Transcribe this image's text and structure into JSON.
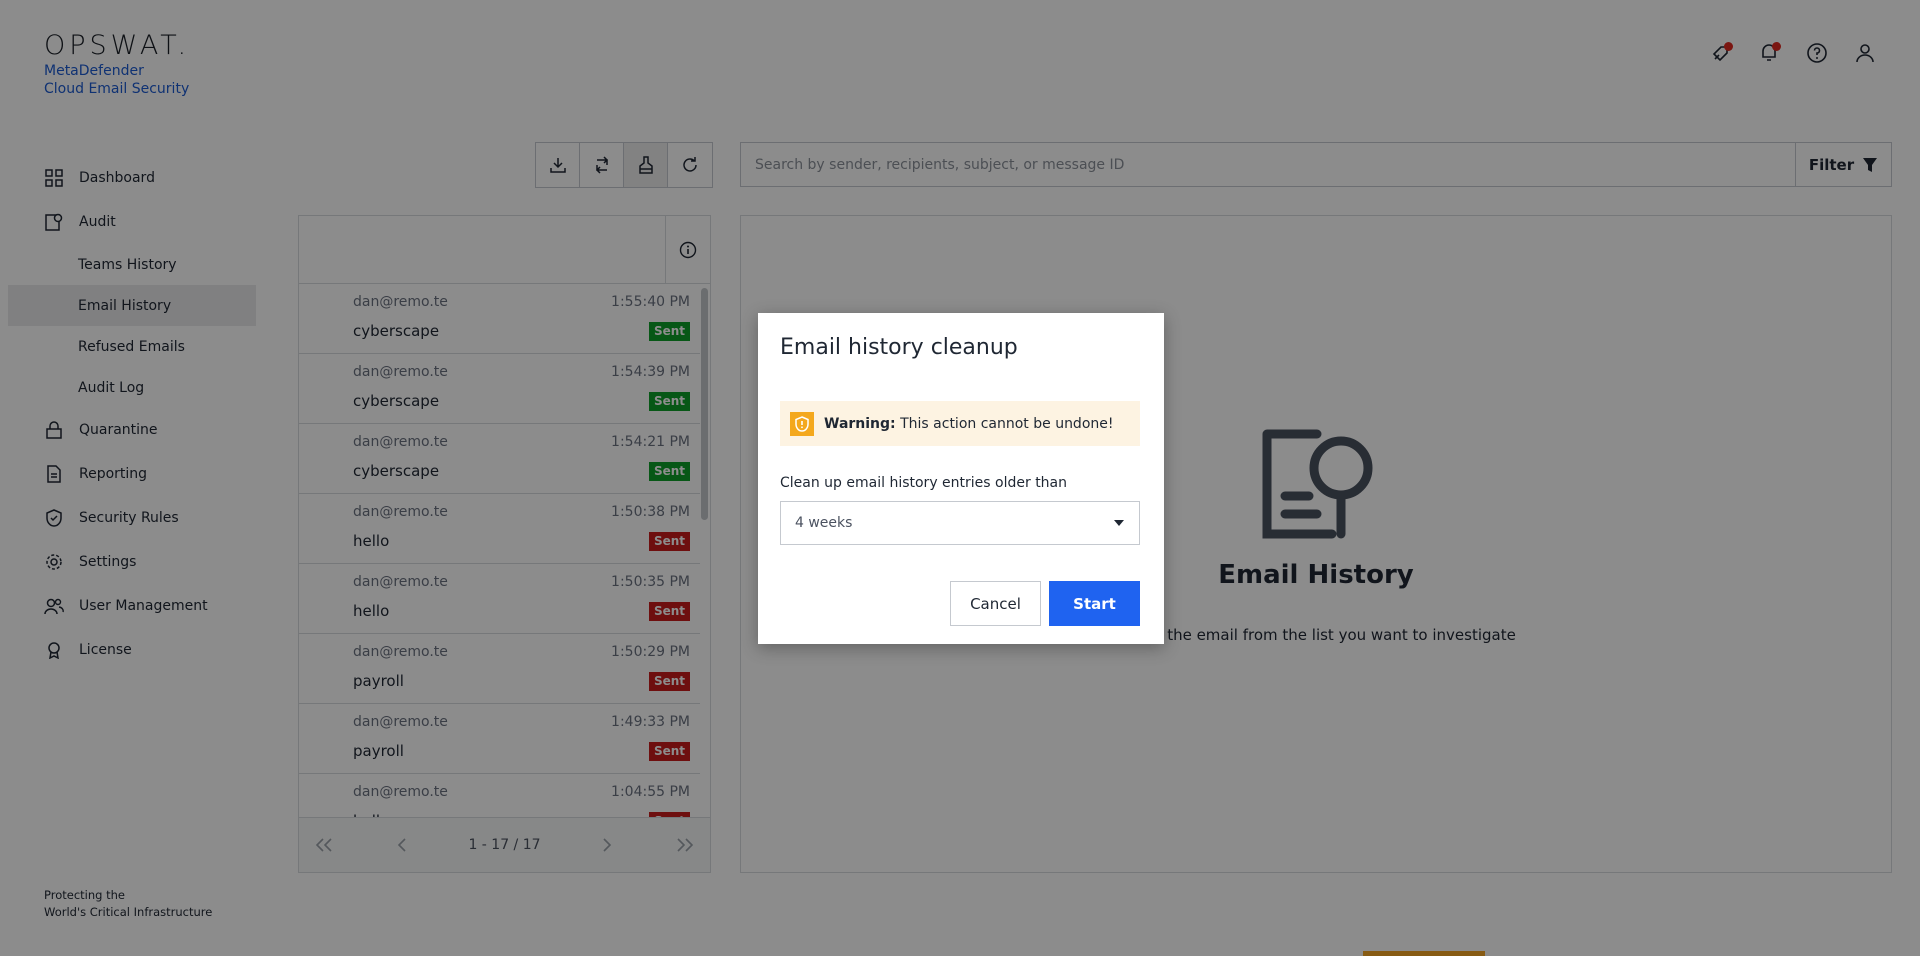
{
  "brand": {
    "logo": "OPSWAT.",
    "product_line1": "MetaDefender",
    "product_line2": "Cloud Email Security",
    "tagline_line1": "Protecting the",
    "tagline_line2": "World's Critical Infrastructure"
  },
  "topbar": {
    "icons": [
      "rocket-icon",
      "notifications-icon",
      "help-icon",
      "user-icon"
    ],
    "alert_color": "#e0281f"
  },
  "nav": {
    "dashboard": "Dashboard",
    "audit": "Audit",
    "teams_history": "Teams History",
    "email_history": "Email History",
    "refused_emails": "Refused Emails",
    "audit_log": "Audit Log",
    "quarantine": "Quarantine",
    "reporting": "Reporting",
    "security_rules": "Security Rules",
    "settings": "Settings",
    "user_management": "User Management",
    "license": "License"
  },
  "toolbar": {
    "icons": [
      "download-icon",
      "sync-icon",
      "cleanup-icon",
      "refresh-icon"
    ]
  },
  "search": {
    "placeholder": "Search by sender, recipients, subject, or message ID",
    "filter_label": "Filter"
  },
  "emails": [
    {
      "sender": "dan@remo.te",
      "time": "1:55:40 PM",
      "subject": "cyberscape",
      "status": "Sent",
      "status_color": "#0d9e29"
    },
    {
      "sender": "dan@remo.te",
      "time": "1:54:39 PM",
      "subject": "cyberscape",
      "status": "Sent",
      "status_color": "#0d9e29"
    },
    {
      "sender": "dan@remo.te",
      "time": "1:54:21 PM",
      "subject": "cyberscape",
      "status": "Sent",
      "status_color": "#0d9e29"
    },
    {
      "sender": "dan@remo.te",
      "time": "1:50:38 PM",
      "subject": "hello",
      "status": "Sent",
      "status_color": "#c91c1c"
    },
    {
      "sender": "dan@remo.te",
      "time": "1:50:35 PM",
      "subject": "hello",
      "status": "Sent",
      "status_color": "#c91c1c"
    },
    {
      "sender": "dan@remo.te",
      "time": "1:50:29 PM",
      "subject": "payroll",
      "status": "Sent",
      "status_color": "#c91c1c"
    },
    {
      "sender": "dan@remo.te",
      "time": "1:49:33 PM",
      "subject": "payroll",
      "status": "Sent",
      "status_color": "#c91c1c"
    },
    {
      "sender": "dan@remo.te",
      "time": "1:04:55 PM",
      "subject": "hello",
      "status": "Sent",
      "status_color": "#c91c1c"
    }
  ],
  "pager": {
    "range": "1 - 17 / 17"
  },
  "detail": {
    "title": "Email History",
    "hint": "Select the email from the list you want to investigate"
  },
  "modal": {
    "title": "Email history cleanup",
    "warning_label": "Warning:",
    "warning_text": "This action cannot be undone!",
    "field_label": "Clean up email history entries older than",
    "selected_value": "4 weeks",
    "cancel_label": "Cancel",
    "start_label": "Start",
    "accent_color": "#1f63f0",
    "warning_color": "#f4a81d"
  }
}
